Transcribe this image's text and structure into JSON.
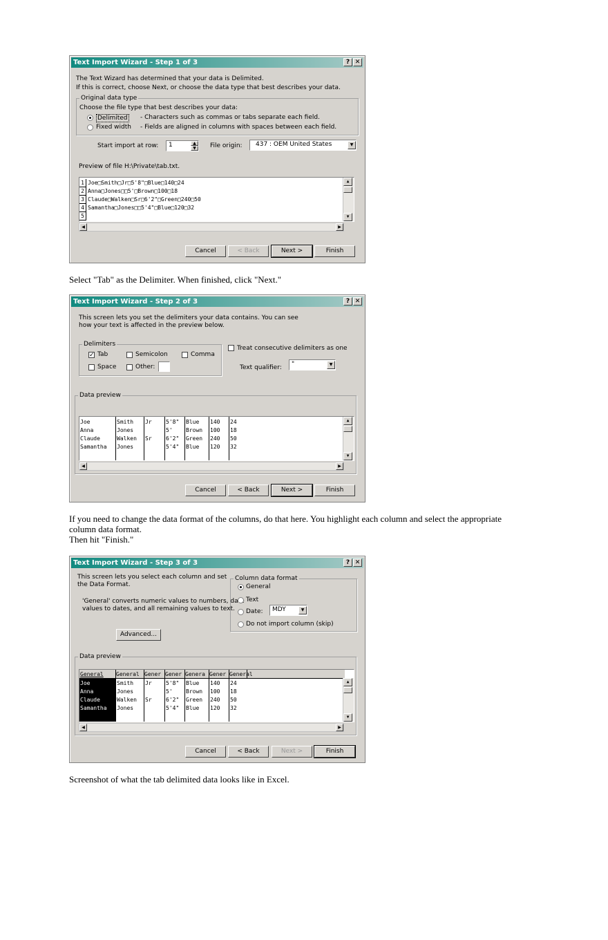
{
  "dialog1": {
    "title": "Text Import Wizard - Step 1 of 3",
    "intro1": "The Text Wizard has determined that your data is Delimited.",
    "intro2": "If this is correct, choose Next, or choose the data type that best describes your data.",
    "group_title": "Original data type",
    "choose_label": "Choose the file type that best describes your data:",
    "radio_delimited": "Delimited",
    "radio_delimited_desc": "- Characters such as commas or tabs separate each field.",
    "radio_fixed": "Fixed width",
    "radio_fixed_desc": "- Fields are aligned in columns with spaces between each field.",
    "start_row_label": "Start import at row:",
    "start_row_value": "1",
    "file_origin_label": "File origin:",
    "file_origin_value": "437 : OEM United States",
    "preview_label": "Preview of file H:\\Private\\tab.txt.",
    "preview_lines": [
      {
        "num": "1",
        "text": "Joe□Smith□Jr□5'8\"□Blue□140□24"
      },
      {
        "num": "2",
        "text": "Anna□Jones□□5'□Brown□100□18"
      },
      {
        "num": "3",
        "text": "Claude□Walken□Sr□6'2\"□Green□240□50"
      },
      {
        "num": "4",
        "text": "Samantha□Jones□□5'4\"□Blue□120□32"
      },
      {
        "num": "5",
        "text": ""
      }
    ],
    "buttons": {
      "cancel": "Cancel",
      "back": "< Back",
      "next": "Next >",
      "finish": "Finish"
    }
  },
  "text1": "Select \"Tab\" as the Delimiter. When finished, click \"Next.\"",
  "dialog2": {
    "title": "Text Import Wizard - Step 2 of 3",
    "intro1": "This screen lets you set the delimiters your data contains.  You can see",
    "intro2": "how your text is affected in the preview below.",
    "delimiters_title": "Delimiters",
    "tab": "Tab",
    "semicolon": "Semicolon",
    "comma": "Comma",
    "space": "Space",
    "other": "Other:",
    "treat_consecutive": "Treat consecutive delimiters as one",
    "text_qualifier_label": "Text qualifier:",
    "text_qualifier_value": "\"",
    "data_preview_title": "Data preview",
    "rows": [
      [
        "Joe",
        "Smith",
        "Jr",
        "5'8\"",
        "Blue",
        "140",
        "24"
      ],
      [
        "Anna",
        "Jones",
        "",
        "5'",
        "Brown",
        "100",
        "18"
      ],
      [
        "Claude",
        "Walken",
        "Sr",
        "6'2\"",
        "Green",
        "240",
        "50"
      ],
      [
        "Samantha",
        "Jones",
        "",
        "5'4\"",
        "Blue",
        "120",
        "32"
      ]
    ],
    "buttons": {
      "cancel": "Cancel",
      "back": "< Back",
      "next": "Next >",
      "finish": "Finish"
    }
  },
  "text2a": "If you need to change the data format of the columns, do that here. You highlight each column and select the appropriate",
  "text2b": "column data format.",
  "text2c": "Then hit \"Finish.\"",
  "dialog3": {
    "title": "Text Import Wizard - Step 3 of 3",
    "intro1": "This screen lets you select each column and set",
    "intro2": "the Data Format.",
    "general_note1": "'General' converts numeric values to numbers, date",
    "general_note2": "values to dates, and all remaining values to text.",
    "advanced": "Advanced...",
    "format_title": "Column data format",
    "general": "General",
    "text": "Text",
    "date": "Date:",
    "date_value": "MDY",
    "skip": "Do not import column (skip)",
    "data_preview_title": "Data preview",
    "headers": [
      "General",
      "General",
      "Gener",
      "Gener",
      "Genera",
      "Gener",
      "General"
    ],
    "rows": [
      [
        "Joe",
        "Smith",
        "Jr",
        "5'8\"",
        "Blue",
        "140",
        "24"
      ],
      [
        "Anna",
        "Jones",
        "",
        "5'",
        "Brown",
        "100",
        "18"
      ],
      [
        "Claude",
        "Walken",
        "Sr",
        "6'2\"",
        "Green",
        "240",
        "50"
      ],
      [
        "Samantha",
        "Jones",
        "",
        "5'4\"",
        "Blue",
        "120",
        "32"
      ]
    ],
    "buttons": {
      "cancel": "Cancel",
      "back": "< Back",
      "next": "Next >",
      "finish": "Finish"
    }
  },
  "text3": "Screenshot of what the tab delimited data looks like in Excel."
}
